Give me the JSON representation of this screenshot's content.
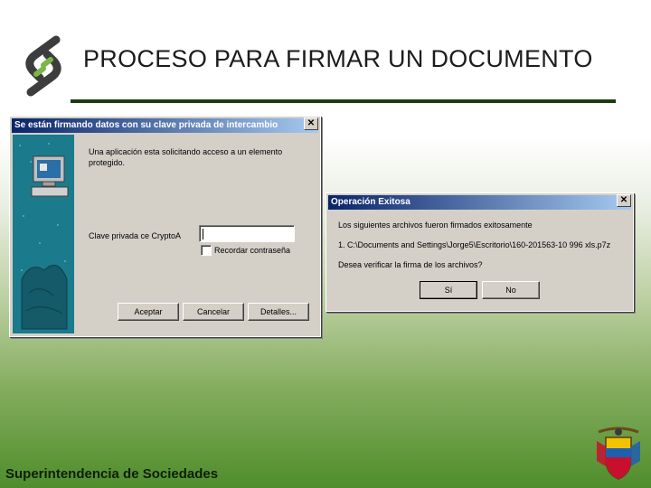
{
  "slide": {
    "title": "PROCESO PARA FIRMAR UN DOCUMENTO",
    "footer": "Superintendencia de Sociedades"
  },
  "dialog_sign": {
    "title": "Se están firmando datos con su clave privada de intercambio",
    "message_line1": "Una aplicación esta solicitando acceso a un elemento",
    "message_line2": "protegido.",
    "password_label": "Clave privada ce CryptoA",
    "password_value": "",
    "remember_label": "Recordar contraseña",
    "remember_checked": false,
    "accept_label": "Aceptar",
    "cancel_label": "Cancelar",
    "details_label": "Detalles..."
  },
  "dialog_success": {
    "title": "Operación Exitosa",
    "line1": "Los siguientes archivos fueron firmados exitosamente",
    "line2": "1. C:\\Documents and Settings\\Jorge5\\Escritorio\\160-201563-10 996 xls.p7z",
    "line3": "Desea verificar la firma de los archivos?",
    "yes_label": "Sí",
    "no_label": "No"
  },
  "colors": {
    "titlebar_start": "#0a246a",
    "titlebar_end": "#a6caf0",
    "dialog_face": "#d4d0c8",
    "side_panel": "#1b7a8c",
    "title_rule": "#1e3a12",
    "background_green": "#4f8d2c"
  },
  "icons": [
    "company-logo",
    "computer-icon",
    "close-icon",
    "coat-of-arms"
  ]
}
